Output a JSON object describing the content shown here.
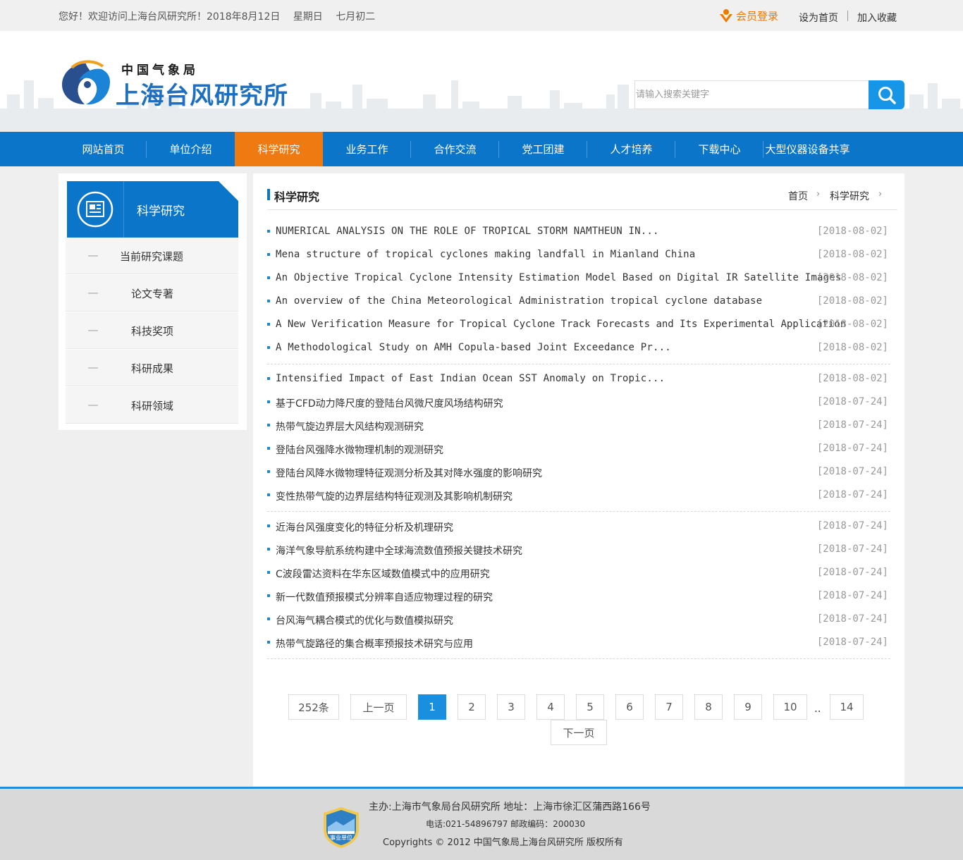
{
  "topbar": {
    "greeting": "您好！欢迎访问上海台风研究所！2018年8月12日",
    "weekday": "星期日",
    "lunar": "七月初二",
    "member_login": "会员登录",
    "set_home": "设为首页",
    "add_favorite": "加入收藏"
  },
  "header": {
    "org_small": "中国气象局",
    "org_big": "上海台风研究所",
    "search_placeholder": "请输入搜索关键字"
  },
  "nav": {
    "items": [
      "网站首页",
      "单位介绍",
      "科学研究",
      "业务工作",
      "合作交流",
      "党工团建",
      "人才培养",
      "下载中心",
      "大型仪器设备共享"
    ],
    "active": 2
  },
  "sidebar": {
    "title": "科学研究",
    "items": [
      "当前研究课题",
      "论文专著",
      "科技奖项",
      "科研成果",
      "科研领域"
    ]
  },
  "main": {
    "title": "科学研究",
    "breadcrumb": [
      "首页",
      "科学研究"
    ],
    "news": [
      {
        "title": "NUMERICAL ANALYSIS ON THE ROLE OF TROPICAL STORM NAMTHEUN IN...",
        "date": "[2018-08-02]"
      },
      {
        "title": "Mena structure of tropical cyclones making landfall in Mianland China",
        "date": "[2018-08-02]"
      },
      {
        "title": "An Objective Tropical Cyclone Intensity Estimation Model Based on Digital IR Satellite Images",
        "date": "[2018-08-02]"
      },
      {
        "title": "An overview of the China Meteorological Administration tropical cyclone database",
        "date": "[2018-08-02]"
      },
      {
        "title": "A New Verification Measure for Tropical Cyclone Track Forecasts and Its Experimental Application",
        "date": "[2018-08-02]"
      },
      {
        "title": "A Methodological Study on AMH Copula-based Joint Exceedance Pr...",
        "date": "[2018-08-02]"
      },
      {
        "title": "Intensified Impact of East Indian Ocean SST Anomaly on Tropic...",
        "date": "[2018-08-02]"
      },
      {
        "title": "基于CFD动力降尺度的登陆台风微尺度风场结构研究",
        "date": "[2018-07-24]"
      },
      {
        "title": "热带气旋边界层大风结构观测研究",
        "date": "[2018-07-24]"
      },
      {
        "title": "登陆台风强降水微物理机制的观测研究",
        "date": "[2018-07-24]"
      },
      {
        "title": "登陆台风降水微物理特征观测分析及其对降水强度的影响研究",
        "date": "[2018-07-24]"
      },
      {
        "title": "变性热带气旋的边界层结构特征观测及其影响机制研究",
        "date": "[2018-07-24]"
      },
      {
        "title": "近海台风强度变化的特征分析及机理研究",
        "date": "[2018-07-24]"
      },
      {
        "title": "海洋气象导航系统构建中全球海流数值预报关键技术研究",
        "date": "[2018-07-24]"
      },
      {
        "title": "C波段雷达资料在华东区域数值模式中的应用研究",
        "date": "[2018-07-24]"
      },
      {
        "title": "新一代数值预报模式分辨率自适应物理过程的研究",
        "date": "[2018-07-24]"
      },
      {
        "title": "台风海气耦合模式的优化与数值模拟研究",
        "date": "[2018-07-24]"
      },
      {
        "title": "热带气旋路径的集合概率预报技术研究与应用",
        "date": "[2018-07-24]"
      }
    ]
  },
  "pager": {
    "total": "252条",
    "prev": "上一页",
    "pages": [
      "1",
      "2",
      "3",
      "4",
      "5",
      "6",
      "7",
      "8",
      "9",
      "10"
    ],
    "current": "1",
    "ellipsis": "..",
    "last": "14",
    "next": "下一页"
  },
  "footer": {
    "sponsor_line": "主办:上海市气象局台风研究所  地址：上海市徐汇区蒲西路166号",
    "contact_line": "电话:021-54896797  邮政编码：200030",
    "copyright": "Copyrights © 2012 中国气象局上海台风研究所 版权所有",
    "badge_text": "事业单位"
  },
  "colors": {
    "brand_blue": "#0b75c9",
    "active_orange": "#f07a12",
    "link_orange": "#f07800",
    "pager_blue": "#1a8fe0"
  }
}
